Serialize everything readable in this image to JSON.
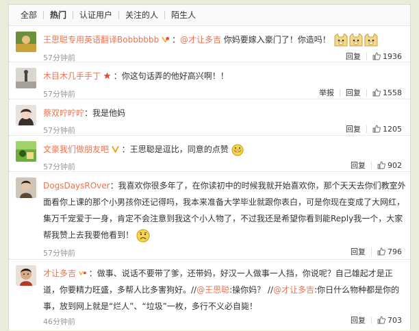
{
  "tabs": [
    "全部",
    "热门",
    "认证用户",
    "关注的人",
    "陌生人"
  ],
  "active_tab": 1,
  "actions": {
    "reply": "回复",
    "report": "举报"
  },
  "comments": [
    {
      "user": "王思聪专用英语翻译Bobbbbbb",
      "colon": "：",
      "mention": "@才让多吉",
      "text": " 你妈要嫁入豪门了！你造吗！",
      "time": "57分钟前",
      "likes": "1936"
    },
    {
      "user": "木目木几手手丁",
      "colon": "：",
      "text": "你这句话弄的他好高兴啊！！",
      "time": "57分钟前",
      "likes": "1558"
    },
    {
      "user": "蔡双咛咛咛",
      "colon": "：",
      "text": "我是他妈",
      "time": "57分钟前",
      "likes": "1205"
    },
    {
      "user": "文豪我们做朋友吧",
      "colon": "：",
      "text": "王思聪是逗比，同意的点赞",
      "time": "57分钟前",
      "likes": "902"
    },
    {
      "user": "DogsDaysROver",
      "colon": "：",
      "text_lines": [
        "我喜欢你很多年了，在你读初中的时候我就开始喜欢你，那个天天去你们教室外",
        "面看你上课的那个小男孩你还记得吗，我本来准备大学毕业就跟你表白，可是你现在变成了大网红，",
        "集万千宠爱于一身，肯定不会注意到我这个小人物了，不过我还是希望你看到能Reply我一个，大家",
        "帮我赞上去我要他看到！"
      ],
      "time": "57分钟前",
      "likes": "796"
    },
    {
      "user": "才让多吉",
      "colon": "：",
      "text_lines": [
        "做事、说话不要带了爹，还带妈，好汉一人做事一人挡，你说呢？自己雄起才是正",
        "道，你要精力旺盛，多帮人比多害狗好。//",
        "事，放到网上就是“烂人”、“垃圾”一枚，多行不义必自毙！"
      ],
      "mention1": "@王思聪",
      "mid1": ":操你妈？ //",
      "mention2": "@才让多吉",
      "mid2": ":你日什么物种都是你的",
      "time": "46分钟前",
      "likes": "703"
    }
  ]
}
